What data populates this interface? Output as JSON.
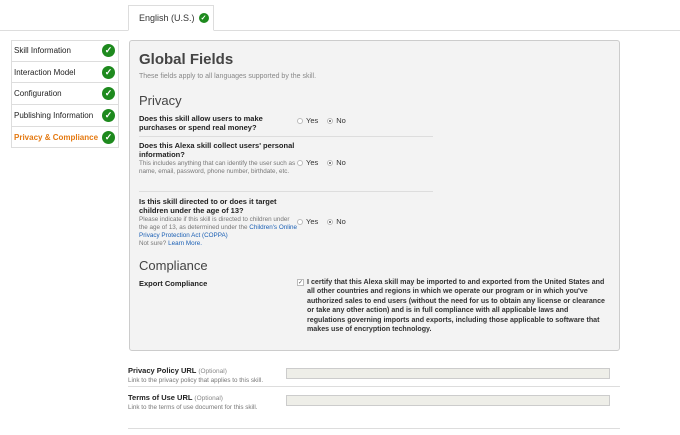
{
  "tab": {
    "language": "English (U.S.)"
  },
  "sidebar": {
    "items": [
      {
        "label": "Skill Information"
      },
      {
        "label": "Interaction Model"
      },
      {
        "label": "Configuration"
      },
      {
        "label": "Publishing Information"
      },
      {
        "label": "Privacy & Compliance",
        "active": true
      }
    ]
  },
  "panel": {
    "title": "Global Fields",
    "subtitle": "These fields apply to all languages supported by the skill.",
    "privacy_heading": "Privacy",
    "questions": [
      {
        "label": "Does this skill allow users to make purchases or spend real money?",
        "help": "",
        "selected": "No"
      },
      {
        "label": "Does this Alexa skill collect users' personal information?",
        "help": "This includes anything that can identify the user such as name, email, password, phone number, birthdate, etc.",
        "selected": "No"
      },
      {
        "label": "Is this skill directed to or does it target children under the age of 13?",
        "help": "Please indicate if this skill is directed to children under the age of 13, as determined under the",
        "help_link": "Children's Online Privacy Protection Act (COPPA)",
        "help_not_sure": "Not sure?",
        "help_learn_more": "Learn More.",
        "selected": "No"
      }
    ],
    "radio_yes": "Yes",
    "radio_no": "No",
    "compliance_heading": "Compliance",
    "export_label": "Export Compliance",
    "export_checked": true,
    "export_text": "I certify that this Alexa skill may be imported to and exported from the United States and all other countries and regions in which we operate our program or in which you've authorized sales to end users (without the need for us to obtain any license or clearance or take any other action) and is in full compliance with all applicable laws and regulations governing imports and exports, including those applicable to software that makes use of encryption technology."
  },
  "privacy_policy": {
    "label": "Privacy Policy URL",
    "optional": "(Optional)",
    "help": "Link to the privacy policy that applies to this skill.",
    "value": ""
  },
  "terms_of_use": {
    "label": "Terms of Use URL",
    "optional": "(Optional)",
    "help": "Link to the terms of use document for this skill.",
    "value": ""
  }
}
